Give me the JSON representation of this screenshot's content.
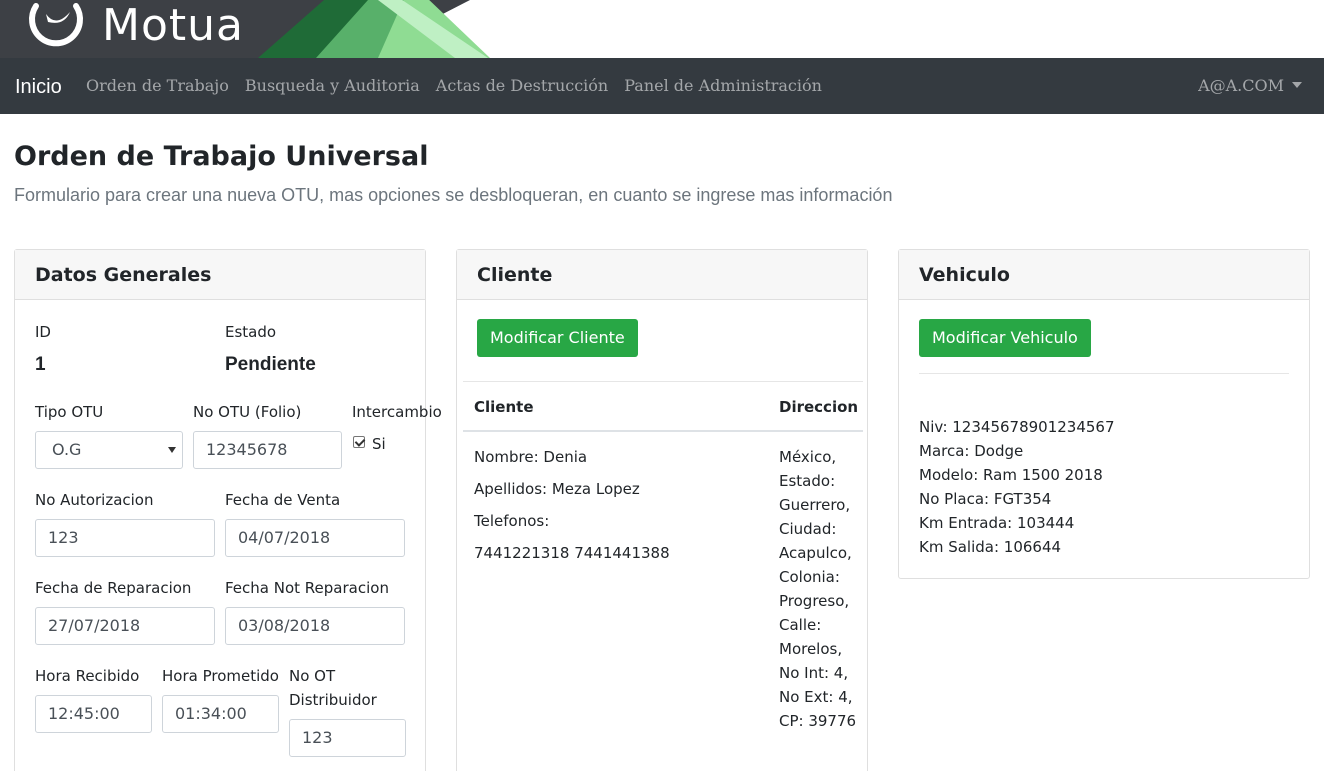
{
  "brand": {
    "name": "Motua"
  },
  "navbar": {
    "brand": "Inicio",
    "links": [
      "Orden de Trabajo",
      "Busqueda y Auditoria",
      "Actas de Destrucción",
      "Panel de Administración"
    ],
    "user": "A@A.COM"
  },
  "page": {
    "title": "Orden de Trabajo Universal",
    "subtitle": "Formulario para crear una nueva OTU, mas opciones se desbloqueran, en cuanto se ingrese mas información"
  },
  "general": {
    "header": "Datos Generales",
    "id_label": "ID",
    "id_value": "1",
    "estado_label": "Estado",
    "estado_value": "Pendiente",
    "tipo_label": "Tipo OTU",
    "tipo_value": "O.G",
    "folio_label": "No OTU (Folio)",
    "folio_value": "12345678",
    "intercambio_label": "Intercambio",
    "intercambio_option": "Si",
    "autorizacion_label": "No Autorizacion",
    "autorizacion_value": "123",
    "venta_label": "Fecha de Venta",
    "venta_value": "04/07/2018",
    "reparacion_label": "Fecha de Reparacion",
    "reparacion_value": "27/07/2018",
    "not_reparacion_label": "Fecha Not Reparacion",
    "not_reparacion_value": "03/08/2018",
    "recibido_label": "Hora Recibido",
    "recibido_value": "12:45:00",
    "prometido_label": "Hora Prometido",
    "prometido_value": "01:34:00",
    "ot_label_1": "No OT",
    "ot_label_2": "Distribuidor",
    "ot_value": "123"
  },
  "cliente": {
    "header": "Cliente",
    "button": "Modificar Cliente",
    "col_cliente": "Cliente",
    "col_direccion": "Direccion",
    "nombre": "Nombre: Denia",
    "apellidos": "Apellidos: Meza Lopez",
    "telefonos_label": "Telefonos:",
    "telefonos": "7441221318 7441441388",
    "direccion": [
      "México,",
      "Estado:",
      "Guerrero,",
      "Ciudad:",
      "Acapulco,",
      "Colonia:",
      "Progreso,",
      "Calle:",
      "Morelos,",
      "No Int: 4,",
      "No Ext: 4,",
      "CP: 39776"
    ]
  },
  "vehiculo": {
    "header": "Vehiculo",
    "button": "Modificar Vehiculo",
    "lines": [
      "Niv: 12345678901234567",
      "Marca: Dodge",
      "Modelo: Ram 1500 2018",
      "No Placa: FGT354",
      "Km Entrada: 103444",
      "Km Salida: 106644"
    ]
  },
  "colors": {
    "navbar": "#343a40",
    "success": "#28a745",
    "brand_green": "#58b06a"
  }
}
